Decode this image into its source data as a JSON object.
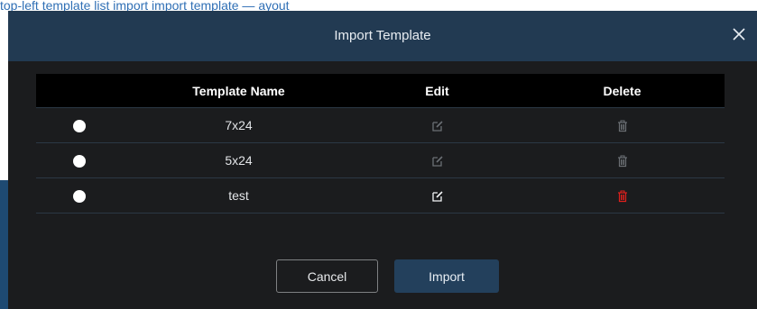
{
  "background": {
    "text": "top-left template list import import template — ayout"
  },
  "dialog": {
    "title": "Import Template",
    "close_icon": "close-icon"
  },
  "table": {
    "columns": [
      "",
      "Template Name",
      "Edit",
      "Delete"
    ],
    "rows": [
      {
        "name": "7x24",
        "edit_enabled": false,
        "delete_enabled": false
      },
      {
        "name": "5x24",
        "edit_enabled": false,
        "delete_enabled": false
      },
      {
        "name": "test",
        "edit_enabled": true,
        "delete_enabled": true
      }
    ]
  },
  "buttons": {
    "cancel": "Cancel",
    "import": "Import"
  },
  "colors": {
    "dialog_bg": "#1b1c1e",
    "header_bg": "#223a52",
    "import_btn_bg": "#23405c",
    "delete_active": "#e0201c",
    "icon_disabled": "#6b6f74"
  }
}
